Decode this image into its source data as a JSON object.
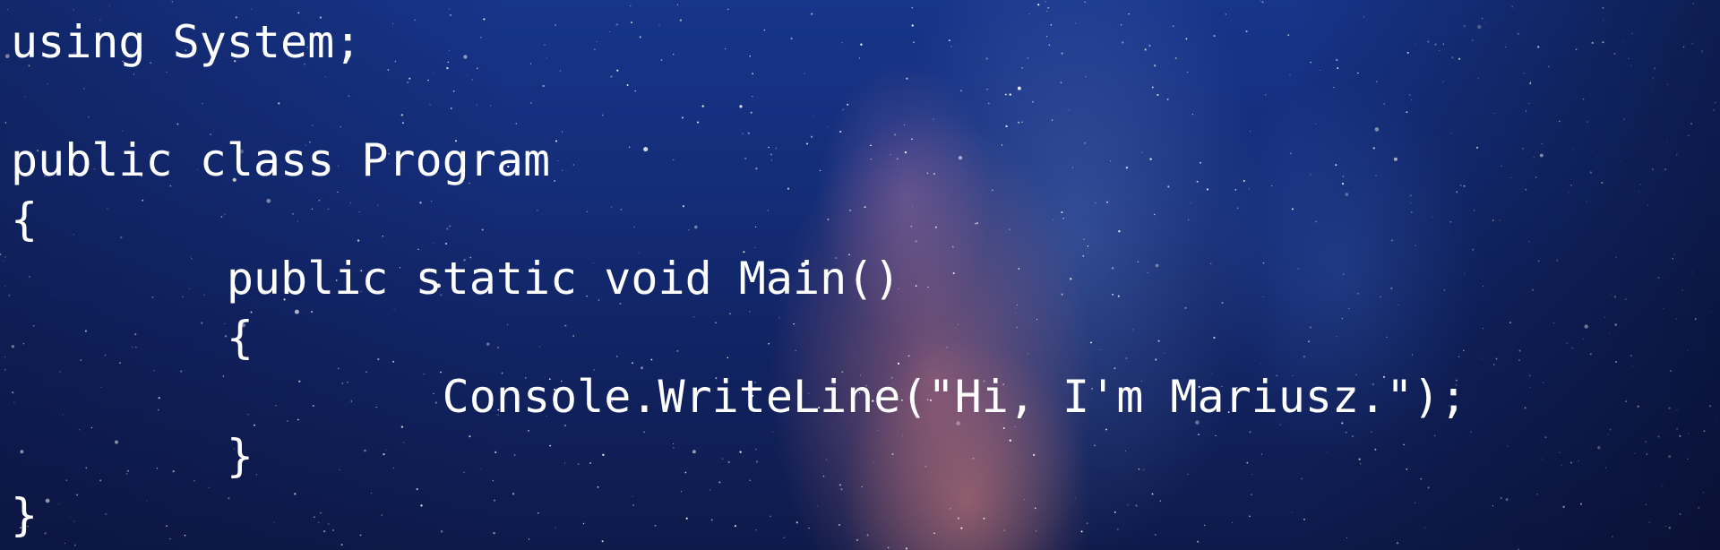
{
  "background": {
    "description_icon": "starry-night-sky",
    "colors": {
      "sky_top": "#17358a",
      "sky_bottom": "#0e1a4a",
      "nebula": "#cd7882",
      "text": "#ffffff"
    }
  },
  "code": {
    "lines": [
      "using System;",
      "",
      "public class Program",
      "{",
      "        public static void Main()",
      "        {",
      "                Console.WriteLine(\"Hi, I'm Mariusz.\");",
      "        }",
      "}"
    ]
  }
}
